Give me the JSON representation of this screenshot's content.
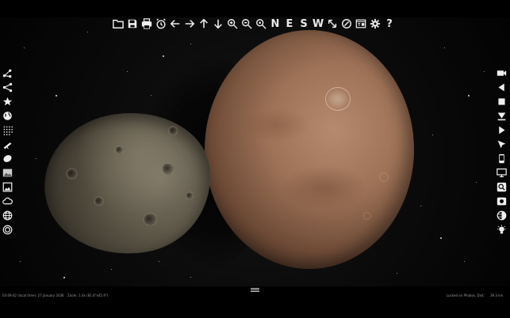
{
  "toolbar": {
    "icons": [
      "folder-icon",
      "save-icon",
      "print-icon",
      "alarm-clock-icon",
      "arrow-left-icon",
      "arrow-right-icon",
      "arrow-up-icon",
      "arrow-down-icon",
      "zoom-in-icon",
      "zoom-out-icon",
      "zoom-reset-icon"
    ],
    "compass": [
      "N",
      "E",
      "S",
      "W"
    ],
    "more_icons": [
      "resize-diagonal-icon",
      "compass-dial-icon",
      "window-panel-icon",
      "gear-icon"
    ],
    "help_label": "?"
  },
  "left_toolbar": [
    "share-node-icon",
    "share-branch-icon",
    "star-tree-icon",
    "globe-icon",
    "dots-grid-icon",
    "telescope-icon",
    "ellipse-icon",
    "image-landscape-icon",
    "image-frame-icon",
    "cloud-icon",
    "globe-grid-icon",
    "target-circle-icon"
  ],
  "right_toolbar": [
    "video-camera-icon",
    "play-reverse-icon",
    "stop-square-icon",
    "step-forward-icon",
    "play-icon",
    "cursor-pointer-icon",
    "phone-icon",
    "monitor-icon",
    "search-window-icon",
    "snapshot-icon",
    "contrast-icon",
    "light-bulb-icon"
  ],
  "status": {
    "time": "03:09:42 (local time): 27 January 2036",
    "zoom": "Zoom: 1.0x (81.8°x45.9°)",
    "locked": "Locked on Phobos. Dist:",
    "distance": "39.3 km"
  },
  "colors": {
    "mars": "#9d7257",
    "phobos": "#5e5849",
    "background": "#0a0a0a"
  }
}
